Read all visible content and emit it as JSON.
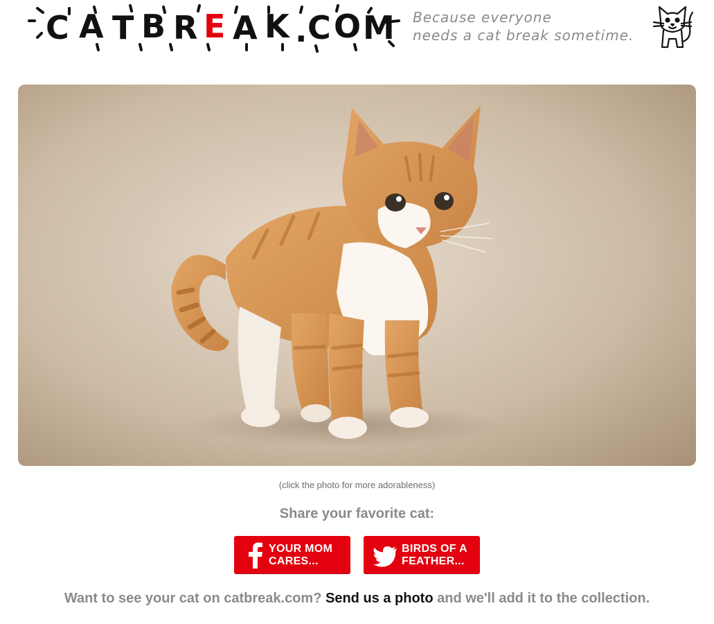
{
  "header": {
    "logo_text": "CATBREAK.COM",
    "logo_letters": [
      "C",
      "A",
      "T",
      "B",
      "R",
      "E",
      "A",
      "K",
      ".",
      "C",
      "O",
      "M"
    ],
    "tagline_line1": "Because everyone",
    "tagline_line2": "needs a cat break sometime.",
    "mascot_icon": "cat-doodle-icon",
    "accent_color": "#e3000f"
  },
  "photo": {
    "caption": "(click the photo for more adorableness)"
  },
  "share": {
    "title": "Share your favorite cat:",
    "facebook_label_line1": "YOUR MOM",
    "facebook_label_line2": "CARES...",
    "twitter_label_line1": "BIRDS OF A",
    "twitter_label_line2": "FEATHER...",
    "facebook_icon": "facebook-icon",
    "twitter_icon": "twitter-icon",
    "button_color": "#e3000f"
  },
  "footer": {
    "prefix": "Want to see your cat on catbreak.com?",
    "link_text": "Send us a photo",
    "suffix": "and we'll add it to the collection."
  }
}
